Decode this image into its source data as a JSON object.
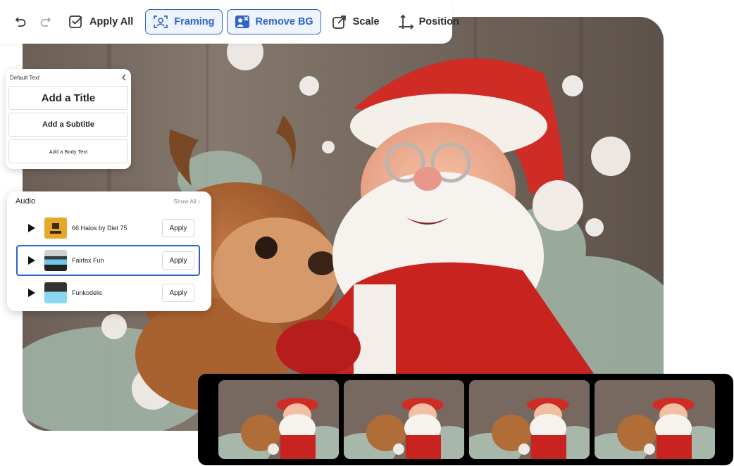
{
  "toolbar": {
    "undo_icon": "undo-icon",
    "redo_icon": "redo-icon",
    "apply_all": "Apply All",
    "framing": "Framing",
    "remove_bg": "Remove BG",
    "scale": "Scale",
    "position": "Position",
    "active_color": "#2f63c9"
  },
  "text_panel": {
    "header": "Default Text",
    "title": "Add a Title",
    "subtitle": "Add a Subtitle",
    "body": "Add a Body Text"
  },
  "audio_panel": {
    "header": "Audio",
    "show_all": "Show All ›",
    "tracks": [
      {
        "name": "66 Halos by Diet 75",
        "apply": "Apply",
        "selected": false
      },
      {
        "name": "Fairfax Fun",
        "apply": "Apply",
        "selected": true
      },
      {
        "name": "Funkodelic",
        "apply": "Apply",
        "selected": false
      }
    ]
  },
  "filmstrip": {
    "frame_count": 4
  }
}
